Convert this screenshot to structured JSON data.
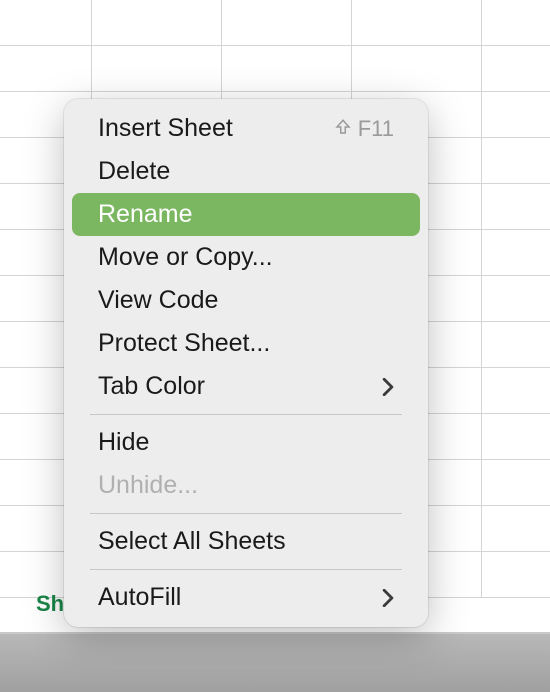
{
  "sheet_tab_partial": "Sh",
  "context_menu": {
    "items": [
      {
        "label": "Insert Sheet",
        "shortcut_glyph": "⇧",
        "shortcut_key": "F11",
        "highlighted": false,
        "disabled": false,
        "has_submenu": false
      },
      {
        "label": "Delete",
        "highlighted": false,
        "disabled": false,
        "has_submenu": false
      },
      {
        "label": "Rename",
        "highlighted": true,
        "disabled": false,
        "has_submenu": false
      },
      {
        "label": "Move or Copy...",
        "highlighted": false,
        "disabled": false,
        "has_submenu": false
      },
      {
        "label": "View Code",
        "highlighted": false,
        "disabled": false,
        "has_submenu": false
      },
      {
        "label": "Protect Sheet...",
        "highlighted": false,
        "disabled": false,
        "has_submenu": false
      },
      {
        "label": "Tab Color",
        "highlighted": false,
        "disabled": false,
        "has_submenu": true
      },
      {
        "separator": true
      },
      {
        "label": "Hide",
        "highlighted": false,
        "disabled": false,
        "has_submenu": false
      },
      {
        "label": "Unhide...",
        "highlighted": false,
        "disabled": true,
        "has_submenu": false
      },
      {
        "separator": true
      },
      {
        "label": "Select All Sheets",
        "highlighted": false,
        "disabled": false,
        "has_submenu": false
      },
      {
        "separator": true
      },
      {
        "label": "AutoFill",
        "highlighted": false,
        "disabled": false,
        "has_submenu": true
      }
    ]
  }
}
